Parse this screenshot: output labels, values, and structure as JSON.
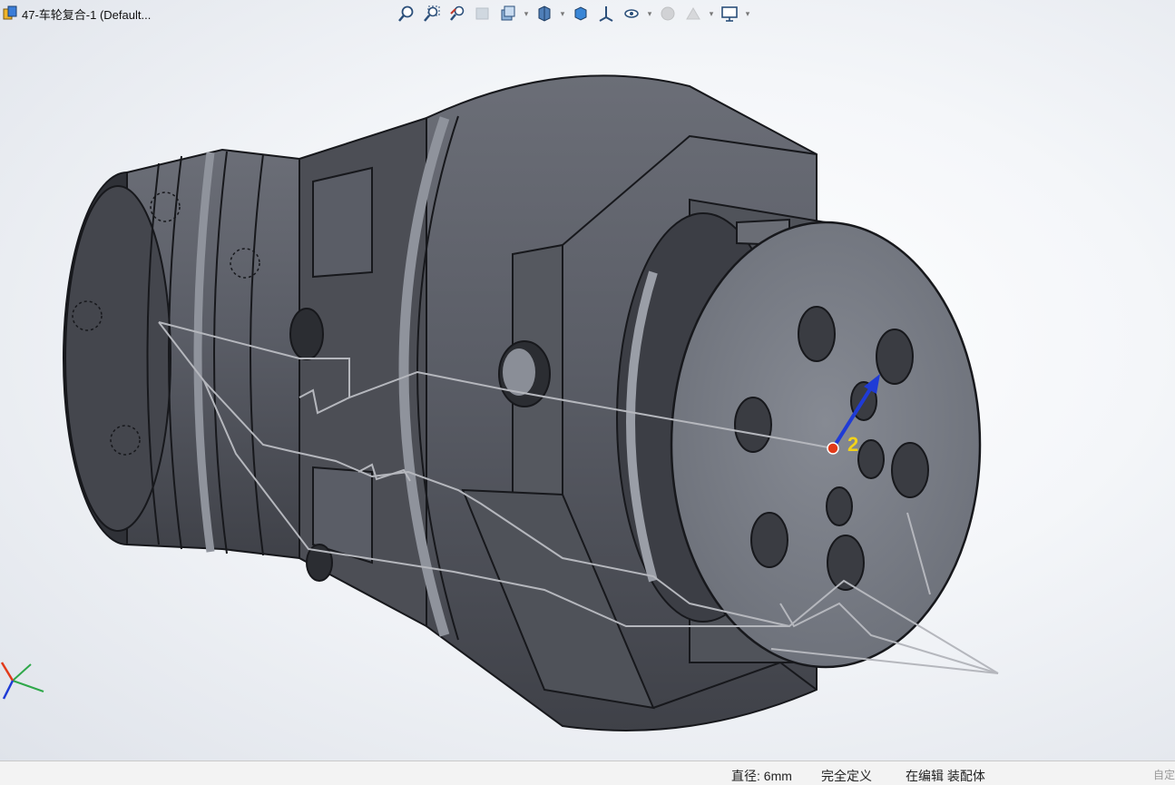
{
  "document": {
    "title": "47-车轮复合-1  (Default..."
  },
  "heads_up_toolbar": {
    "buttons": [
      {
        "icon": "zoom-to-fit-icon",
        "has_dropdown": false,
        "faded": false
      },
      {
        "icon": "zoom-to-area-icon",
        "has_dropdown": false,
        "faded": false
      },
      {
        "icon": "previous-view-icon",
        "has_dropdown": false,
        "faded": false
      },
      {
        "icon": "section-view-icon",
        "has_dropdown": false,
        "faded": true
      },
      {
        "icon": "view-orientation-icon",
        "has_dropdown": true,
        "faded": false
      },
      {
        "icon": "display-style-icon",
        "has_dropdown": true,
        "faded": false
      },
      {
        "icon": "edit-appearance-icon",
        "has_dropdown": false,
        "faded": false
      },
      {
        "icon": "apply-scene-icon",
        "has_dropdown": false,
        "faded": false
      },
      {
        "icon": "hide-show-items-icon",
        "has_dropdown": true,
        "faded": false
      },
      {
        "icon": "view-settings-icon",
        "has_dropdown": false,
        "faded": true
      },
      {
        "icon": "realview-icon",
        "has_dropdown": true,
        "faded": true
      },
      {
        "icon": "display-monitor-icon",
        "has_dropdown": true,
        "faded": false
      }
    ]
  },
  "viewport": {
    "dimension_label": "2",
    "model": "cnc-wheel-fixture-assembly"
  },
  "status_bar": {
    "diameter": "直径: 6mm",
    "definition_state": "完全定义",
    "editing_context": "在编辑 装配体",
    "corner_hint": "自定"
  },
  "colors": {
    "part_face": "#5d6069",
    "part_dark": "#3c3e45",
    "part_light": "#8f939c",
    "edge": "#17181c",
    "sketch_line": "#b5b7bd",
    "origin_point": "#e23a1a",
    "axis_arrow": "#1f3bd6",
    "dimension_text": "#f2d21a"
  }
}
